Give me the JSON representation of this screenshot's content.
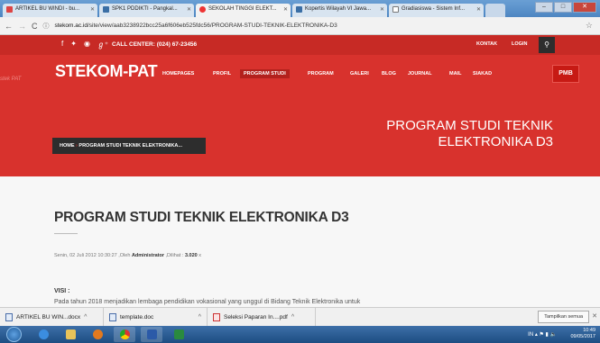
{
  "browser": {
    "tabs": [
      {
        "label": "ARTIKEL BU WINDI - bu..."
      },
      {
        "label": "SPK1 PDDIKTI - Pangkal..."
      },
      {
        "label": "SEKOLAH TINGGI ELEKT..."
      },
      {
        "label": "Kopertis Wilayah VI Jawa..."
      },
      {
        "label": "Gradiasiswa - Sistem Inf..."
      }
    ],
    "url_host": "stekom.ac.id",
    "url_path": "/site/view/aab3238922bcc25a6f606eb525fdc56/PROGRAM-STUDI-TEKNIK-ELEKTRONIKA-D3"
  },
  "topbar": {
    "call_center": "CALL CENTER: (024) 67-23456",
    "kontak": "KONTAK",
    "login": "LOGIN"
  },
  "site": {
    "logo": "STEKOM-PAT",
    "side_text": "stek PAT",
    "menu": [
      "HOMEPAGES",
      "PROFIL",
      "PROGRAM STUDI",
      "PROGRAM",
      "GALERI",
      "BLOG",
      "JOURNAL",
      "MAIL",
      "SIAKAD"
    ],
    "pmb": "PMB"
  },
  "breadcrumb": {
    "home": "HOME",
    "current": "PROGRAM STUDI TEKNIK ELEKTRONIKA..."
  },
  "hero_title_line1": "PROGRAM STUDI TEKNIK",
  "hero_title_line2": "ELEKTRONIKA D3",
  "article": {
    "title": "PROGRAM STUDI TEKNIK ELEKTRONIKA D3",
    "meta_prefix": "Senin, 02 Juli 2012 10:30:27 ,Oleh",
    "author": "Administrator",
    "meta_views_label": ",Dilihat :",
    "views": "3.020",
    "meta_suffix": "x",
    "visi_heading": "VISI :",
    "visi_text": "Pada tahun 2018 menjadikan lembaga pendidikan vokasional yang unggul di Bidang Teknik Elektronika untuk"
  },
  "downloads": {
    "items": [
      "ARTIKEL BU WIN...docx",
      "template.doc",
      "Seleksi Paparan In....pdf"
    ],
    "show_all": "Tampilkan semua"
  },
  "taskbar": {
    "lang": "IN",
    "time": "10:49",
    "date": "09/05/2017"
  }
}
